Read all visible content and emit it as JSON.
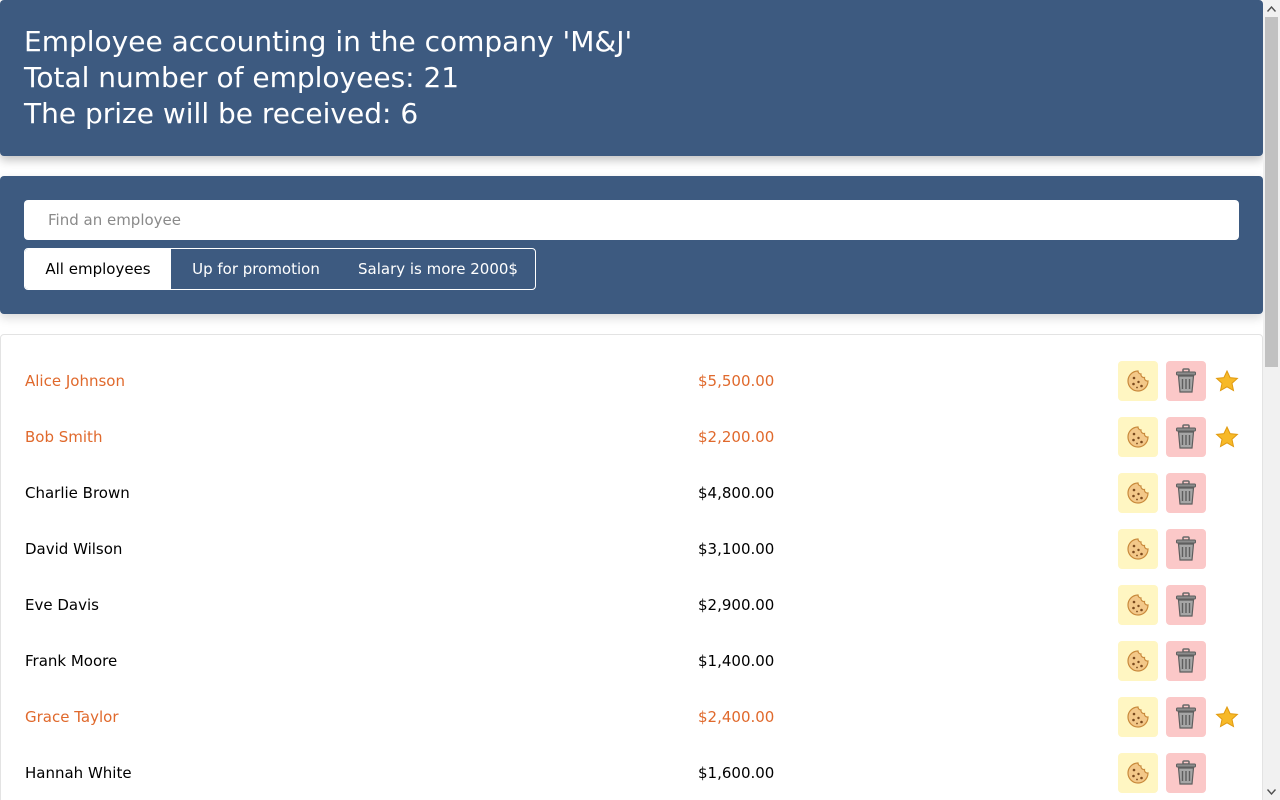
{
  "header": {
    "title": "Employee accounting in the company 'M&J'",
    "total_employees": "Total number of employees: 21",
    "prize_count": "The prize will be received: 6"
  },
  "search": {
    "placeholder": "Find an employee",
    "value": ""
  },
  "filters": [
    {
      "label": "All employees",
      "active": true
    },
    {
      "label": "Up for promotion",
      "active": false
    },
    {
      "label": "Salary is more 2000$",
      "active": false
    }
  ],
  "employees": [
    {
      "name": "Alice Johnson",
      "salary": "$5,500.00",
      "increase": true,
      "rise": true
    },
    {
      "name": "Bob Smith",
      "salary": "$2,200.00",
      "increase": true,
      "rise": true
    },
    {
      "name": "Charlie Brown",
      "salary": "$4,800.00",
      "increase": false,
      "rise": false
    },
    {
      "name": "David Wilson",
      "salary": "$3,100.00",
      "increase": false,
      "rise": false
    },
    {
      "name": "Eve Davis",
      "salary": "$2,900.00",
      "increase": false,
      "rise": false
    },
    {
      "name": "Frank Moore",
      "salary": "$1,400.00",
      "increase": false,
      "rise": false
    },
    {
      "name": "Grace Taylor",
      "salary": "$2,400.00",
      "increase": true,
      "rise": true
    },
    {
      "name": "Hannah White",
      "salary": "$1,600.00",
      "increase": false,
      "rise": false
    }
  ],
  "icons": {
    "cookie": "cookie-icon",
    "trash": "trash-icon",
    "star": "star-icon"
  },
  "colors": {
    "panel": "#3d5a80",
    "highlight_text": "#e0692c",
    "cookie_bg": "#fff6c2",
    "trash_bg": "#fbc8c8",
    "star": "#f7b928"
  }
}
